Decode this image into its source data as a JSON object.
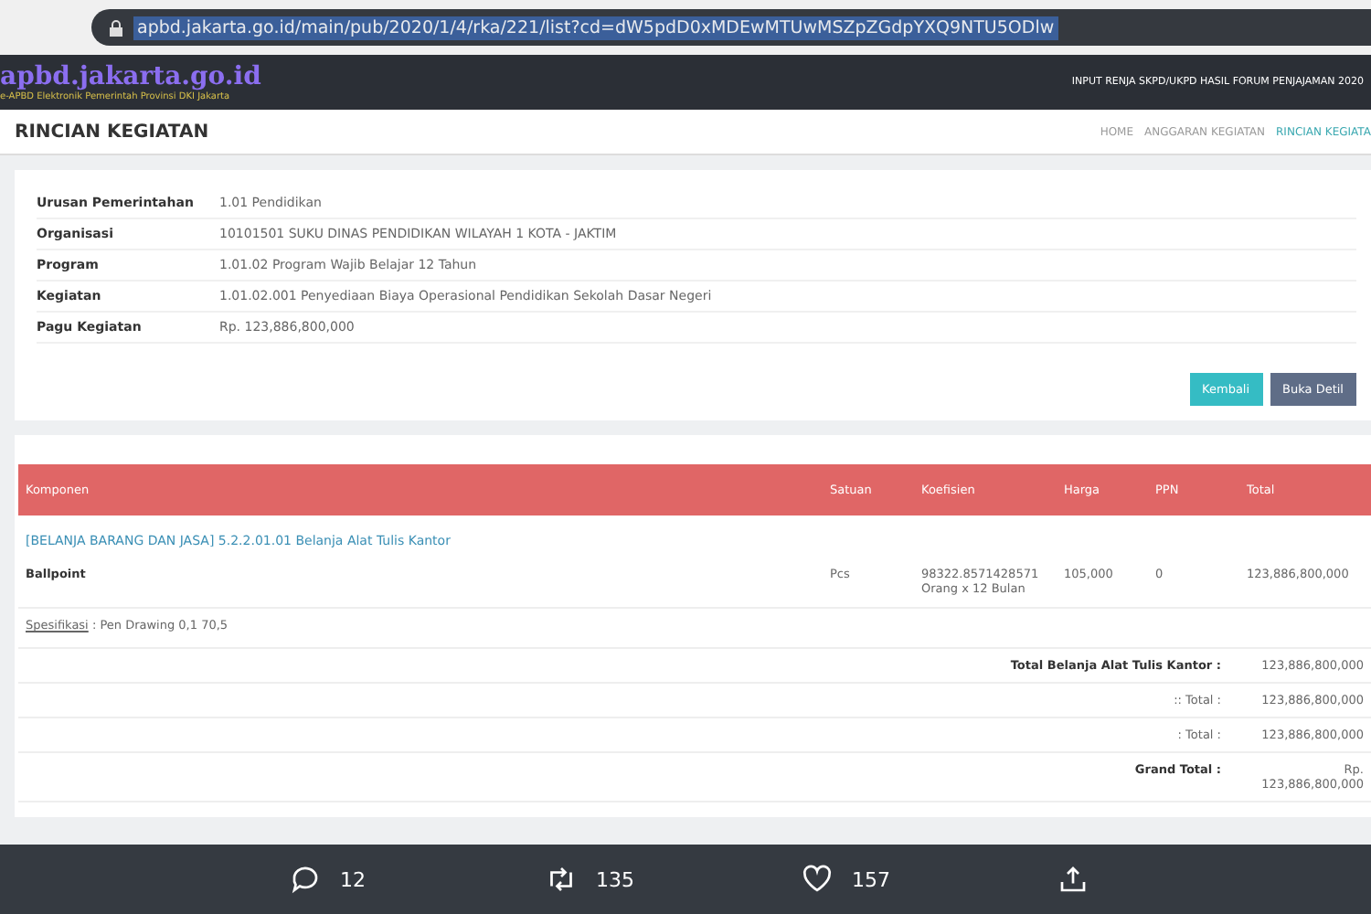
{
  "browser": {
    "url": "apbd.jakarta.go.id/main/pub/2020/1/4/rka/221/list?cd=dW5pdD0xMDEwMTUwMSZpZGdpYXQ9NTU5ODlw"
  },
  "header": {
    "logo": "apbd.jakarta.go.id",
    "logo_subtitle": "e-APBD Elektronik Pemerintah Provinsi DKI Jakarta",
    "title": "INPUT RENJA SKPD/UKPD HASIL FORUM PENJAJAMAN 2020"
  },
  "page": {
    "title": "RINCIAN KEGIATAN",
    "breadcrumb": [
      "HOME",
      "ANGGARAN KEGIATAN",
      "RINCIAN KEGIATA"
    ]
  },
  "details": [
    {
      "label": "Urusan Pemerintahan",
      "value": "1.01 Pendidikan"
    },
    {
      "label": "Organisasi",
      "value": "10101501 SUKU DINAS PENDIDIKAN WILAYAH 1 KOTA - JAKTIM"
    },
    {
      "label": "Program",
      "value": "1.01.02 Program Wajib Belajar 12 Tahun"
    },
    {
      "label": "Kegiatan",
      "value": "1.01.02.001 Penyediaan Biaya Operasional Pendidikan Sekolah Dasar Negeri"
    },
    {
      "label": "Pagu Kegiatan",
      "value": "Rp. 123,886,800,000"
    }
  ],
  "buttons": [
    {
      "label": "Kembali",
      "kind": "info"
    },
    {
      "label": "Buka Detil",
      "kind": "secondary"
    }
  ],
  "table": {
    "columns": [
      "Komponen",
      "Satuan",
      "Koefisien",
      "Harga",
      "PPN",
      "Total"
    ],
    "group": "[BELANJA BARANG DAN JASA] 5.2.2.01.01 Belanja Alat Tulis Kantor",
    "rows": [
      {
        "komponen": "Ballpoint",
        "satuan": "Pcs",
        "koefisien": [
          "98322.8571428571",
          "Orang x 12 Bulan"
        ],
        "harga": "105,000",
        "ppn": "0",
        "total": "123,886,800,000"
      }
    ],
    "spec": {
      "label": "Spesifikasi",
      "value": ": Pen Drawing 0,1 70,5"
    },
    "totals": [
      {
        "label": "Total Belanja Alat Tulis Kantor :",
        "value": "123,886,800,000",
        "bold": true
      },
      {
        "label": ":: Total :",
        "value": "123,886,800,000",
        "bold": false
      },
      {
        "label": ": Total :",
        "value": "123,886,800,000",
        "bold": false
      },
      {
        "label": "Grand Total :",
        "value": "Rp. 123,886,800,000",
        "bold": true
      }
    ]
  },
  "tweet_actions": [
    {
      "kind": "reply",
      "count": "12"
    },
    {
      "kind": "retweet",
      "count": "135"
    },
    {
      "kind": "like",
      "count": "157"
    },
    {
      "kind": "share"
    }
  ]
}
